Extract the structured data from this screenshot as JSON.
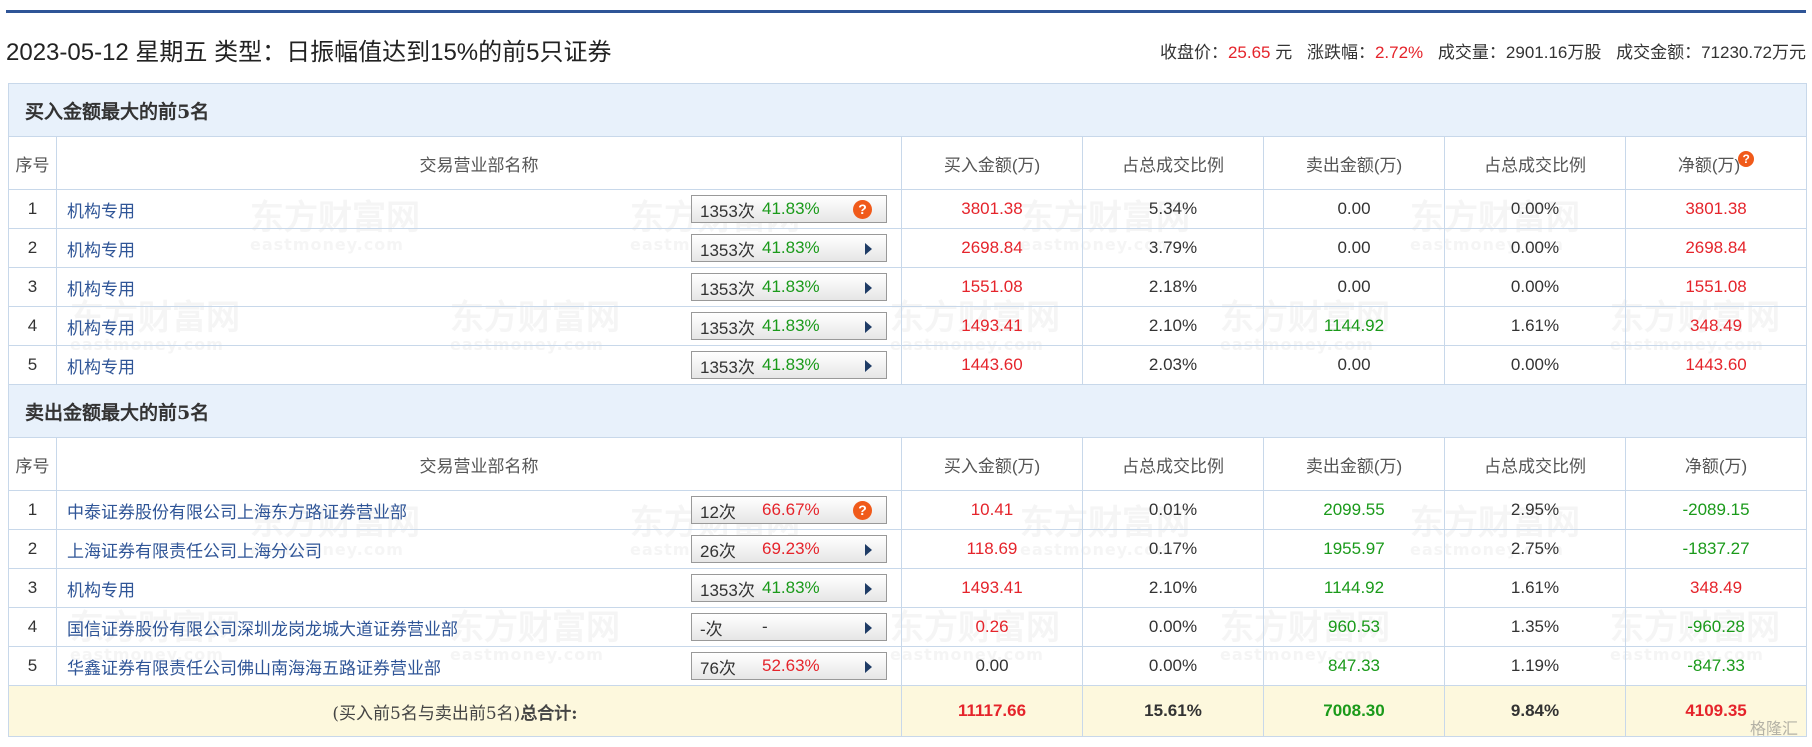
{
  "header": {
    "title": "2023-05-12 星期五 类型：日振幅值达到15%的前5只证券",
    "close_label": "收盘价：",
    "close_value": "25.65",
    "close_unit": " 元",
    "change_label": "涨跌幅：",
    "change_value": "2.72%",
    "volume_label": "成交量：",
    "volume_value": "2901.16万股",
    "amount_label": "成交金额：",
    "amount_value": "71230.72万元"
  },
  "buy_section": {
    "title": "买入金额最大的前5名",
    "columns": [
      "序号",
      "交易营业部名称",
      "买入金额(万)",
      "占总成交比例",
      "卖出金额(万)",
      "占总成交比例",
      "净额(万)"
    ],
    "rows": [
      {
        "no": "1",
        "name": "机构专用",
        "count": "1353次",
        "pct": "41.83%",
        "pct_color": "green",
        "buy": "3801.38",
        "buy_ratio": "5.34%",
        "sell": "0.00",
        "sell_ratio": "0.00%",
        "net": "3801.38",
        "net_color": "red",
        "icon": "help"
      },
      {
        "no": "2",
        "name": "机构专用",
        "count": "1353次",
        "pct": "41.83%",
        "pct_color": "green",
        "buy": "2698.84",
        "buy_ratio": "3.79%",
        "sell": "0.00",
        "sell_ratio": "0.00%",
        "net": "2698.84",
        "net_color": "red",
        "icon": "arrow"
      },
      {
        "no": "3",
        "name": "机构专用",
        "count": "1353次",
        "pct": "41.83%",
        "pct_color": "green",
        "buy": "1551.08",
        "buy_ratio": "2.18%",
        "sell": "0.00",
        "sell_ratio": "0.00%",
        "net": "1551.08",
        "net_color": "red",
        "icon": "arrow"
      },
      {
        "no": "4",
        "name": "机构专用",
        "count": "1353次",
        "pct": "41.83%",
        "pct_color": "green",
        "buy": "1493.41",
        "buy_ratio": "2.10%",
        "sell": "1144.92",
        "sell_ratio": "1.61%",
        "net": "348.49",
        "net_color": "red",
        "icon": "arrow"
      },
      {
        "no": "5",
        "name": "机构专用",
        "count": "1353次",
        "pct": "41.83%",
        "pct_color": "green",
        "buy": "1443.60",
        "buy_ratio": "2.03%",
        "sell": "0.00",
        "sell_ratio": "0.00%",
        "net": "1443.60",
        "net_color": "red",
        "icon": "arrow"
      }
    ]
  },
  "sell_section": {
    "title": "卖出金额最大的前5名",
    "columns": [
      "序号",
      "交易营业部名称",
      "买入金额(万)",
      "占总成交比例",
      "卖出金额(万)",
      "占总成交比例",
      "净额(万)"
    ],
    "rows": [
      {
        "no": "1",
        "name": "中泰证券股份有限公司上海东方路证券营业部",
        "count": "12次",
        "pct": "66.67%",
        "pct_color": "red",
        "buy": "10.41",
        "buy_ratio": "0.01%",
        "sell": "2099.55",
        "sell_ratio": "2.95%",
        "net": "-2089.15",
        "net_color": "green",
        "icon": "help"
      },
      {
        "no": "2",
        "name": "上海证券有限责任公司上海分公司",
        "count": "26次",
        "pct": "69.23%",
        "pct_color": "red",
        "buy": "118.69",
        "buy_ratio": "0.17%",
        "sell": "1955.97",
        "sell_ratio": "2.75%",
        "net": "-1837.27",
        "net_color": "green",
        "icon": "arrow"
      },
      {
        "no": "3",
        "name": "机构专用",
        "count": "1353次",
        "pct": "41.83%",
        "pct_color": "green",
        "buy": "1493.41",
        "buy_ratio": "2.10%",
        "sell": "1144.92",
        "sell_ratio": "1.61%",
        "net": "348.49",
        "net_color": "red",
        "icon": "arrow"
      },
      {
        "no": "4",
        "name": "国信证券股份有限公司深圳龙岗龙城大道证券营业部",
        "count": "-次",
        "pct": "-",
        "pct_color": "black",
        "buy": "0.26",
        "buy_ratio": "0.00%",
        "sell": "960.53",
        "sell_ratio": "1.35%",
        "net": "-960.28",
        "net_color": "green",
        "icon": "arrow"
      },
      {
        "no": "5",
        "name": "华鑫证券有限责任公司佛山南海海五路证券营业部",
        "count": "76次",
        "pct": "52.63%",
        "pct_color": "red",
        "buy": "0.00",
        "buy_color": "black",
        "buy_ratio": "0.00%",
        "sell": "847.33",
        "sell_ratio": "1.19%",
        "net": "-847.33",
        "net_color": "green",
        "icon": "arrow"
      }
    ]
  },
  "total": {
    "label_prefix": "(买入前5名与卖出前5名)",
    "label_bold": "总合计:",
    "buy": "11117.66",
    "buy_ratio": "15.61%",
    "sell": "7008.30",
    "sell_ratio": "9.84%",
    "net": "4109.35"
  },
  "watermark": {
    "text": "东方财富网",
    "sub": "eastmoney.com"
  },
  "corner_logo": "格隆汇"
}
